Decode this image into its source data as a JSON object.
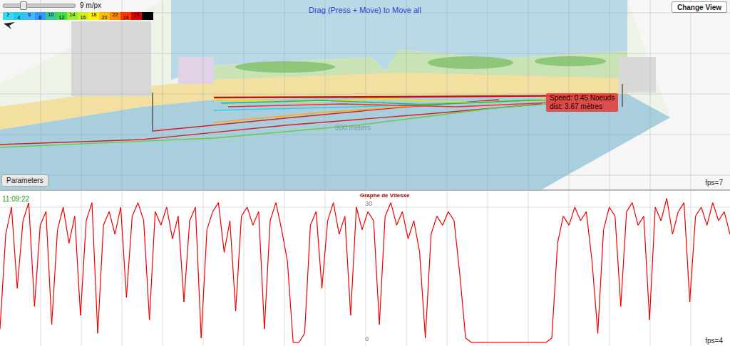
{
  "map": {
    "scale": {
      "label": "9 m/px",
      "level": 0.27
    },
    "legend": [
      {
        "value": "2",
        "color": "#33ddee"
      },
      {
        "value": "4",
        "color": "#22ccee"
      },
      {
        "value": "6",
        "color": "#44bbff"
      },
      {
        "value": "8",
        "color": "#3399ff"
      },
      {
        "value": "10",
        "color": "#33cc99"
      },
      {
        "value": "12",
        "color": "#44dd44"
      },
      {
        "value": "14",
        "color": "#99ee33"
      },
      {
        "value": "16",
        "color": "#ccee22"
      },
      {
        "value": "18",
        "color": "#ffee00"
      },
      {
        "value": "20",
        "color": "#ffbb00"
      },
      {
        "value": "22",
        "color": "#ff8800"
      },
      {
        "value": "24",
        "color": "#ff3300"
      },
      {
        "value": "26",
        "color": "#dd0000"
      }
    ],
    "hint": "Drag (Press + Move) to Move all",
    "change_view": "Change View",
    "tooltip": {
      "speed": "Speed: 0.45 Noeuds",
      "dist": "dist: 3.67 mètres"
    },
    "distance_label": "800 meters",
    "parameters": "Parameters",
    "fps": "fps=7"
  },
  "chart": {
    "time": "11:09:22",
    "title": "Graphe de Vitesse",
    "ticks": [
      "30",
      "0"
    ],
    "fps": "fps=4",
    "values": [
      3,
      24,
      30,
      12,
      27,
      31,
      8,
      26,
      29,
      4,
      25,
      30,
      22,
      28,
      6,
      27,
      31,
      2,
      26,
      29,
      24,
      30,
      10,
      28,
      31,
      27,
      5,
      29,
      26,
      30,
      23,
      28,
      9,
      27,
      30,
      1,
      25,
      29,
      31,
      20,
      27,
      7,
      28,
      30,
      26,
      29,
      3,
      27,
      31,
      25,
      18,
      0,
      0,
      2,
      26,
      29,
      12,
      27,
      31,
      24,
      28,
      6,
      30,
      25,
      29,
      27,
      4,
      28,
      31,
      26,
      29,
      23,
      27,
      20,
      1,
      24,
      28,
      26,
      29,
      27,
      15,
      1,
      0,
      0,
      0,
      0,
      0,
      0,
      0,
      0,
      0,
      0,
      0,
      0,
      0,
      0,
      1,
      22,
      28,
      26,
      30,
      27,
      29,
      18,
      2,
      25,
      30,
      28,
      8,
      29,
      31,
      26,
      28,
      5,
      30,
      27,
      32,
      24,
      29,
      31,
      9,
      28,
      30,
      26,
      31,
      27,
      29,
      24
    ]
  }
}
